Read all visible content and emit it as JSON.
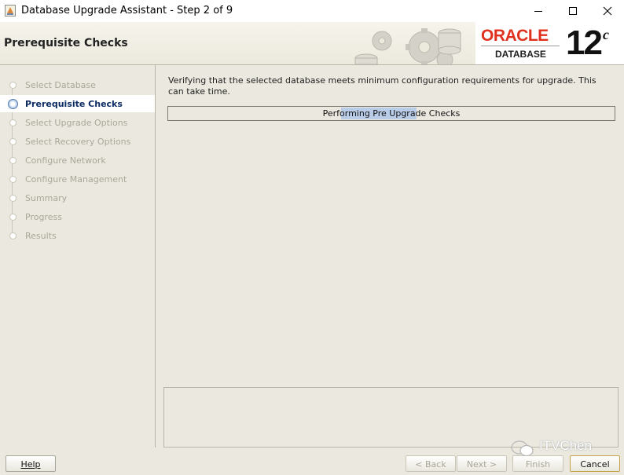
{
  "window": {
    "title": "Database Upgrade Assistant - Step 2 of 9",
    "minimize_icon": "minimize-icon",
    "maximize_icon": "maximize-icon",
    "close_icon": "close-icon"
  },
  "header": {
    "page_title": "Prerequisite Checks",
    "logo": {
      "brand": "ORACLE",
      "product": "DATABASE",
      "version": "12",
      "version_suffix": "c"
    }
  },
  "steps": [
    {
      "label": "Select Database",
      "state": "pending"
    },
    {
      "label": "Prerequisite Checks",
      "state": "active"
    },
    {
      "label": "Select Upgrade Options",
      "state": "pending"
    },
    {
      "label": "Select Recovery Options",
      "state": "pending"
    },
    {
      "label": "Configure Network",
      "state": "pending"
    },
    {
      "label": "Configure Management",
      "state": "pending"
    },
    {
      "label": "Summary",
      "state": "pending"
    },
    {
      "label": "Progress",
      "state": "pending"
    },
    {
      "label": "Results",
      "state": "pending"
    }
  ],
  "main": {
    "description": "Verifying that the selected database meets minimum configuration requirements for upgrade. This can take time.",
    "progress_text": "Performing Pre Upgrade Checks"
  },
  "buttons": {
    "help": "Help",
    "back": "< Back",
    "next": "Next >",
    "finish": "Finish",
    "cancel": "Cancel"
  },
  "watermark": "ITVChen",
  "colors": {
    "background": "#ebe9df",
    "active_step": "#0b2a63",
    "oracle_red": "#e0301e",
    "progress_highlight": "#b9cde8"
  }
}
